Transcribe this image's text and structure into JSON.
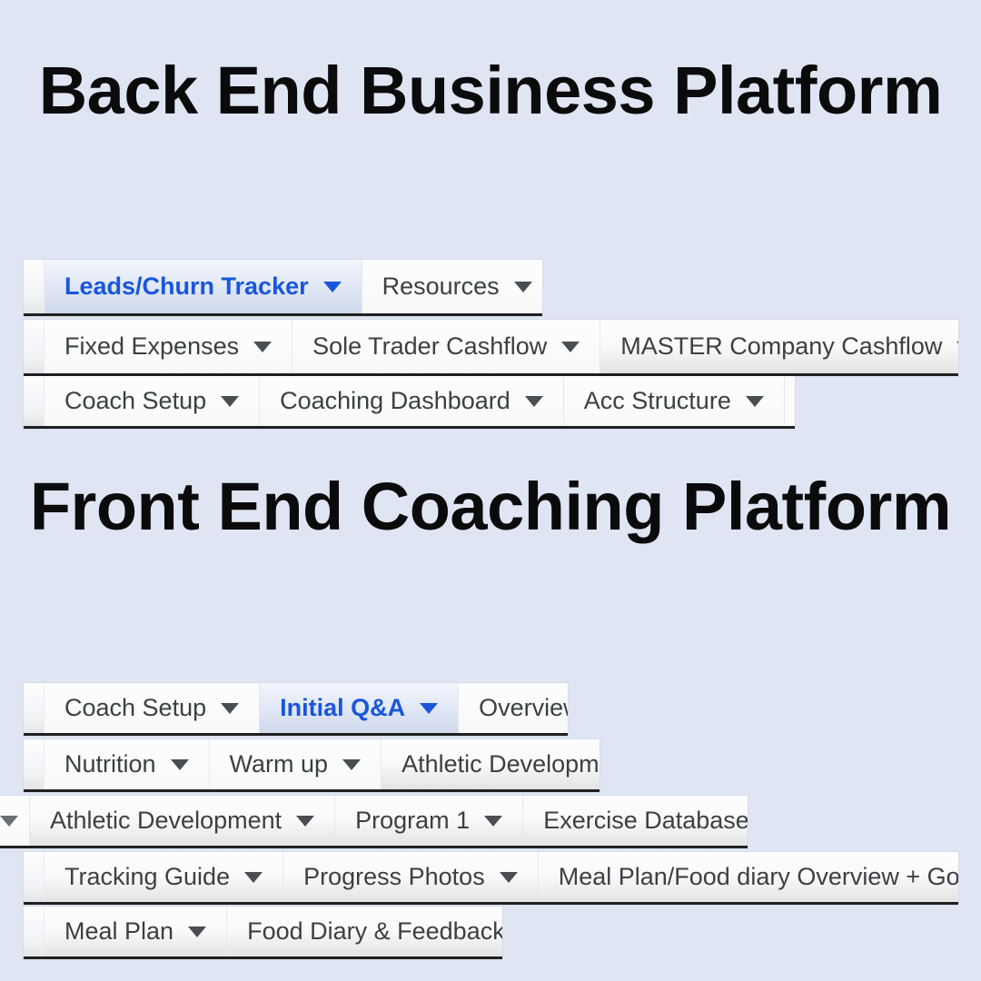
{
  "colors": {
    "page_background": "#dfe5f3",
    "active_tab_text": "#1a56db",
    "tab_text": "#3c4043",
    "strip_background": "#fbfbfc",
    "strip_border": "#202020"
  },
  "sections": [
    {
      "id": "backend",
      "title": "Back End Business Platform",
      "rows": [
        {
          "id": "backend-row-1",
          "tabs": [
            {
              "label": "Leads/Churn Tracker",
              "active": true,
              "caret": true
            },
            {
              "label": "Resources",
              "active": false,
              "caret": true
            }
          ]
        },
        {
          "id": "backend-row-2",
          "tabs": [
            {
              "label": "Fixed Expenses",
              "active": false,
              "caret": true
            },
            {
              "label": "Sole Trader Cashflow",
              "active": false,
              "caret": true
            },
            {
              "label": "MASTER Company Cashflow",
              "active": false,
              "caret": true
            }
          ]
        },
        {
          "id": "backend-row-3",
          "tabs": [
            {
              "label": "Coach Setup",
              "active": false,
              "caret": true
            },
            {
              "label": "Coaching Dashboard",
              "active": false,
              "caret": true
            },
            {
              "label": "Acc Structure",
              "active": false,
              "caret": true
            }
          ]
        }
      ]
    },
    {
      "id": "frontend",
      "title": "Front End Coaching Platform",
      "rows": [
        {
          "id": "frontend-row-1",
          "tabs": [
            {
              "label": "Coach Setup",
              "active": false,
              "caret": true
            },
            {
              "label": "Initial Q&A",
              "active": true,
              "caret": true
            },
            {
              "label": "Overview",
              "active": false,
              "caret": true
            }
          ]
        },
        {
          "id": "frontend-row-2",
          "tabs": [
            {
              "label": "Nutrition",
              "active": false,
              "caret": true
            },
            {
              "label": "Warm up",
              "active": false,
              "caret": true
            },
            {
              "label": "Athletic Development",
              "active": false,
              "caret": true
            }
          ]
        },
        {
          "id": "frontend-row-3",
          "tabs": [
            {
              "label": "Athletic Development",
              "active": false,
              "caret": true
            },
            {
              "label": "Program 1",
              "active": false,
              "caret": true
            },
            {
              "label": "Exercise Database",
              "active": false,
              "caret": true
            }
          ]
        },
        {
          "id": "frontend-row-4",
          "tabs": [
            {
              "label": "Tracking Guide",
              "active": false,
              "caret": true
            },
            {
              "label": "Progress Photos",
              "active": false,
              "caret": true
            },
            {
              "label": "Meal Plan/Food diary Overview + Goals",
              "active": false,
              "caret": true
            }
          ]
        },
        {
          "id": "frontend-row-5",
          "tabs": [
            {
              "label": "Meal Plan",
              "active": false,
              "caret": true
            },
            {
              "label": "Food Diary & Feedback",
              "active": false,
              "caret": true
            }
          ]
        }
      ]
    }
  ],
  "icons": {
    "dropdown": "chevron-down-icon"
  }
}
